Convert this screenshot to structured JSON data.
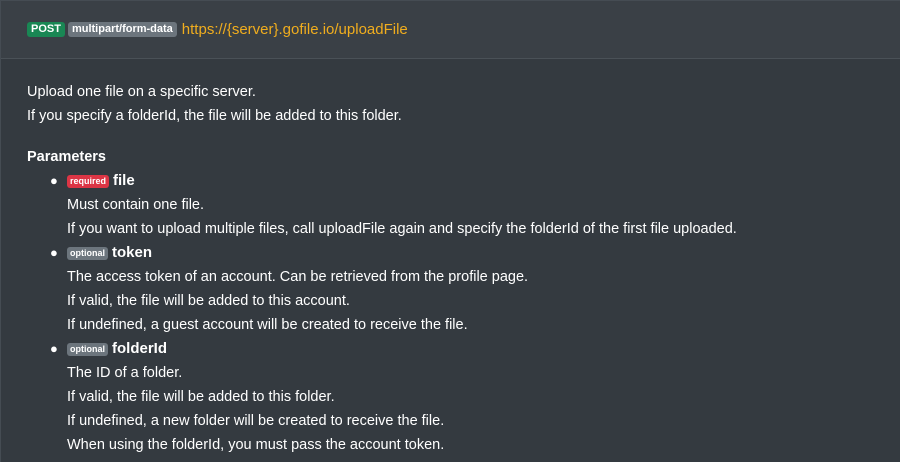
{
  "endpoint": {
    "method": "POST",
    "content_type": "multipart/form-data",
    "url": "https://{server}.gofile.io/uploadFile"
  },
  "description": [
    "Upload one file on a specific server.",
    "If you specify a folderId, the file will be added to this folder."
  ],
  "parameters_title": "Parameters",
  "parameters": [
    {
      "tag": "required",
      "name": "file",
      "lines": [
        "Must contain one file.",
        "If you want to upload multiple files, call uploadFile again and specify the folderId of the first file uploaded."
      ]
    },
    {
      "tag": "optional",
      "name": "token",
      "lines": [
        "The access token of an account. Can be retrieved from the profile page.",
        "If valid, the file will be added to this account.",
        "If undefined, a guest account will be created to receive the file."
      ]
    },
    {
      "tag": "optional",
      "name": "folderId",
      "lines": [
        "The ID of a folder.",
        "If valid, the file will be added to this folder.",
        "If undefined, a new folder will be created to receive the file.",
        "When using the folderId, you must pass the account token."
      ]
    }
  ],
  "colors": {
    "post_badge": "#198754",
    "required_tag": "#dc3545",
    "optional_tag": "#6c757d",
    "url": "#f0ad1e"
  }
}
